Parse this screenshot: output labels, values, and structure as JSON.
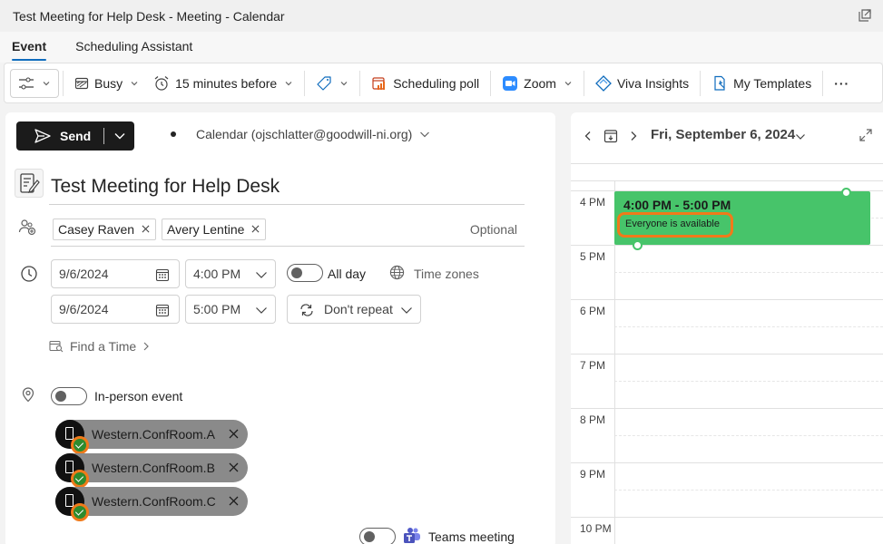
{
  "window": {
    "title": "Test Meeting for Help Desk - Meeting - Calendar"
  },
  "tabs": [
    {
      "label": "Event",
      "active": true
    },
    {
      "label": "Scheduling Assistant",
      "active": false
    }
  ],
  "toolbar": {
    "busy_label": "Busy",
    "reminder_label": "15 minutes before",
    "poll_label": "Scheduling poll",
    "zoom_label": "Zoom",
    "viva_label": "Viva Insights",
    "templates_label": "My Templates",
    "more_label": "···"
  },
  "form": {
    "send_label": "Send",
    "calendar_label": "Calendar (ojschlatter@goodwill-ni.org)",
    "title": "Test Meeting for Help Desk",
    "attendees": [
      "Casey Raven",
      "Avery Lentine"
    ],
    "optional_label": "Optional",
    "start_date": "9/6/2024",
    "start_time": "4:00 PM",
    "end_date": "9/6/2024",
    "end_time": "5:00 PM",
    "all_day_label": "All day",
    "timezones_label": "Time zones",
    "repeat_label": "Don't repeat",
    "find_time_label": "Find a Time",
    "in_person_label": "In-person event",
    "rooms": [
      "Western.ConfRoom.A",
      "Western.ConfRoom.B",
      "Western.ConfRoom.C"
    ],
    "teams_label": "Teams meeting"
  },
  "calendar": {
    "date_label": "Fri, September 6, 2024",
    "hours": [
      "4 PM",
      "5 PM",
      "6 PM",
      "7 PM",
      "8 PM",
      "9 PM",
      "10 PM"
    ],
    "event_time": "4:00 PM - 5:00 PM",
    "event_status": "Everyone is available",
    "event_color": "#47c46a"
  },
  "colors": {
    "accent": "#0f6cbd",
    "highlight": "#f07a1a"
  }
}
